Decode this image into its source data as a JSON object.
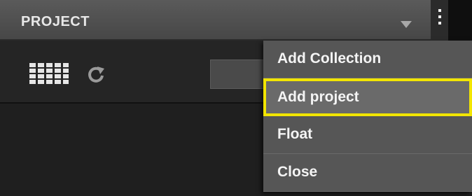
{
  "panel": {
    "title": "PROJECT",
    "menu_icon": "triangle-down-icon",
    "options_icon": "vertical-ellipsis-icon"
  },
  "toolbar": {
    "grid_icon": "grid-view-icon",
    "refresh_icon": "refresh-icon"
  },
  "context_menu": {
    "items": [
      {
        "label": "Add Collection"
      },
      {
        "label": "Add project",
        "highlighted": true
      },
      {
        "label": "Float"
      },
      {
        "label": "Close"
      }
    ],
    "highlight_color": "#f2e500"
  },
  "colors": {
    "header": "#4f4f4f",
    "menu_background": "#565656",
    "panel_background": "#1c1c1c"
  }
}
